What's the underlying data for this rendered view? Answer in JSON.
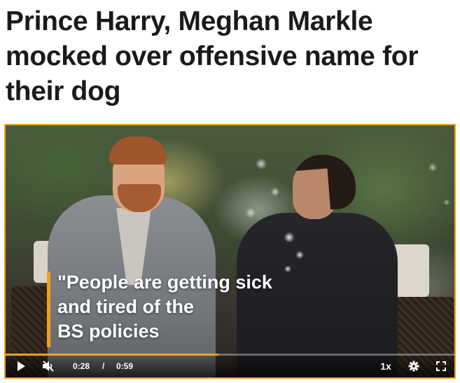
{
  "article": {
    "headline": "Prince Harry, Meghan Markle mocked over offensive name for their dog"
  },
  "video": {
    "caption": "\"People are getting sick\nand tired of the\nBS policies",
    "accent_color": "#f2a01b",
    "progress": 0.475,
    "controls": {
      "play_icon": "play-icon",
      "mute_icon": "speaker-muted-icon",
      "current_time": "0:28",
      "time_separator": "/",
      "duration": "0:59",
      "speed": "1x",
      "settings_icon": "gear-icon",
      "fullscreen_icon": "fullscreen-icon"
    }
  }
}
